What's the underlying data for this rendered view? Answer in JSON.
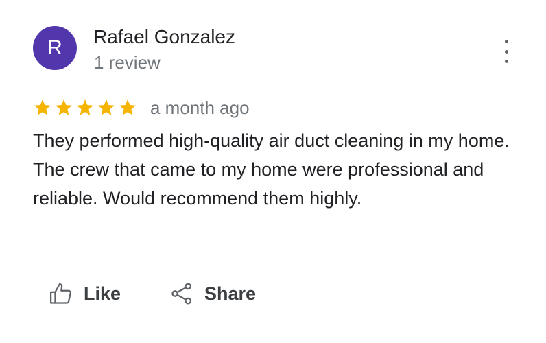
{
  "review": {
    "avatar_letter": "R",
    "avatar_color": "#5236ab",
    "author_name": "Rafael Gonzalez",
    "review_count": "1 review",
    "rating": 5,
    "rating_max": 5,
    "star_color": "#f4b400",
    "date": "a month ago",
    "text": "They performed high-quality air duct cleaning in my home. The crew that came to my home were professional and reliable. Would recommend them highly."
  },
  "actions": {
    "like_label": "Like",
    "like_icon": "thumbs-up-icon",
    "share_label": "Share",
    "share_icon": "share-icon"
  },
  "menu": {
    "icon": "more-vert-icon"
  }
}
